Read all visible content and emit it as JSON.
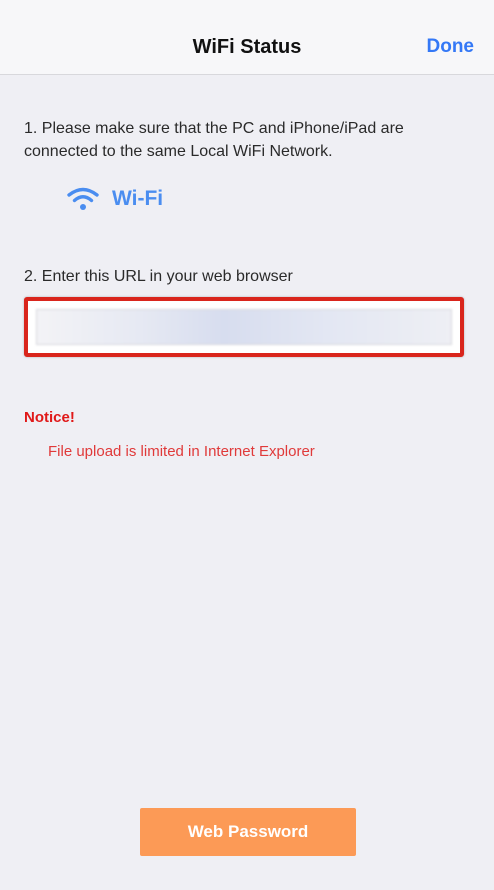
{
  "navbar": {
    "title": "WiFi Status",
    "done_label": "Done"
  },
  "steps": {
    "step1": "1. Please make sure that the PC and iPhone/iPad are connected to the same Local WiFi Network.",
    "wifi_label": "Wi-Fi",
    "step2": "2. Enter this URL in your web browser"
  },
  "notice": {
    "title": "Notice!",
    "text": "File upload is limited in Internet Explorer"
  },
  "footer": {
    "web_password_label": "Web Password"
  },
  "colors": {
    "accent": "#3478f6",
    "wifi": "#4a8df0",
    "highlight_border": "#d9251c",
    "notice": "#e01818",
    "button": "#fc9a56"
  },
  "icons": {
    "wifi": "wifi-icon"
  }
}
